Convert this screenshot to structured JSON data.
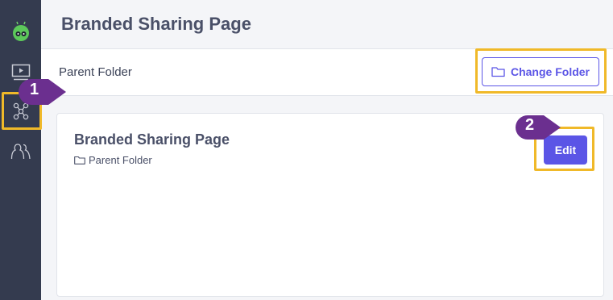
{
  "sidebar": {
    "items": [
      {
        "icon": "robot-logo-icon"
      },
      {
        "icon": "video-icon"
      },
      {
        "icon": "network-icon",
        "active": true
      },
      {
        "icon": "users-icon"
      }
    ]
  },
  "header": {
    "title": "Branded Sharing Page"
  },
  "folder_bar": {
    "label": "Parent Folder",
    "change_button": "Change Folder"
  },
  "card": {
    "title": "Branded Sharing Page",
    "folder": "Parent Folder",
    "edit_button": "Edit"
  },
  "callouts": [
    {
      "number": "1"
    },
    {
      "number": "2"
    }
  ],
  "colors": {
    "sidebar": "#343b4f",
    "accent": "#5b55e6",
    "highlight": "#f0b929",
    "callout": "#6b2f8f"
  }
}
